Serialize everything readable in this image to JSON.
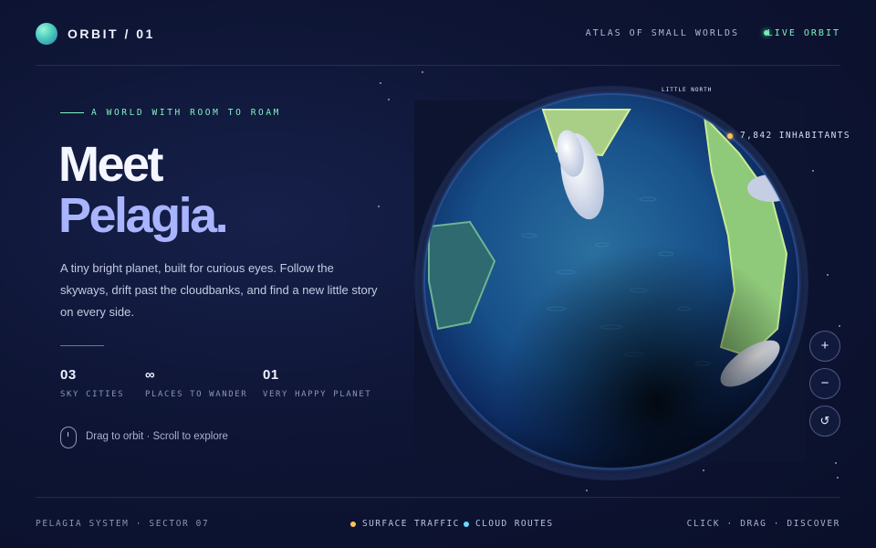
{
  "header": {
    "brand": "ORBIT / 01",
    "nav_atlas": "ATLAS OF SMALL WORLDS",
    "live_label": "LIVE ORBIT"
  },
  "hero": {
    "eyebrow": "A WORLD WITH ROOM TO ROAM",
    "title_line1": "Meet",
    "title_line2": "Pelagia.",
    "description": "A tiny bright planet, built for curious eyes. Follow the skyways, drift past the cloudbanks, and find a new little story on every side.",
    "stats": [
      {
        "value": "03",
        "label": "SKY CITIES"
      },
      {
        "value": "∞",
        "label": "PLACES TO WANDER"
      },
      {
        "value": "01",
        "label": "VERY HAPPY PLANET"
      }
    ],
    "hint": "Drag to orbit · Scroll to explore"
  },
  "planet": {
    "north_tag": "LITTLE NORTH",
    "inhabitants": "7,842 INHABITANTS"
  },
  "controls": {
    "zoom_in": "+",
    "zoom_out": "−",
    "reset": "↺"
  },
  "footer": {
    "left": "PELAGIA SYSTEM · SECTOR 07",
    "legend": [
      {
        "label": "SURFACE TRAFFIC",
        "color": "#ffc35a"
      },
      {
        "label": "CLOUD ROUTES",
        "color": "#6fd6f5"
      }
    ],
    "right": "CLICK · DRAG · DISCOVER"
  },
  "colors": {
    "accent_green": "#7ef5c2",
    "accent_violet": "#a9b4ff",
    "background": "#0e1535"
  }
}
